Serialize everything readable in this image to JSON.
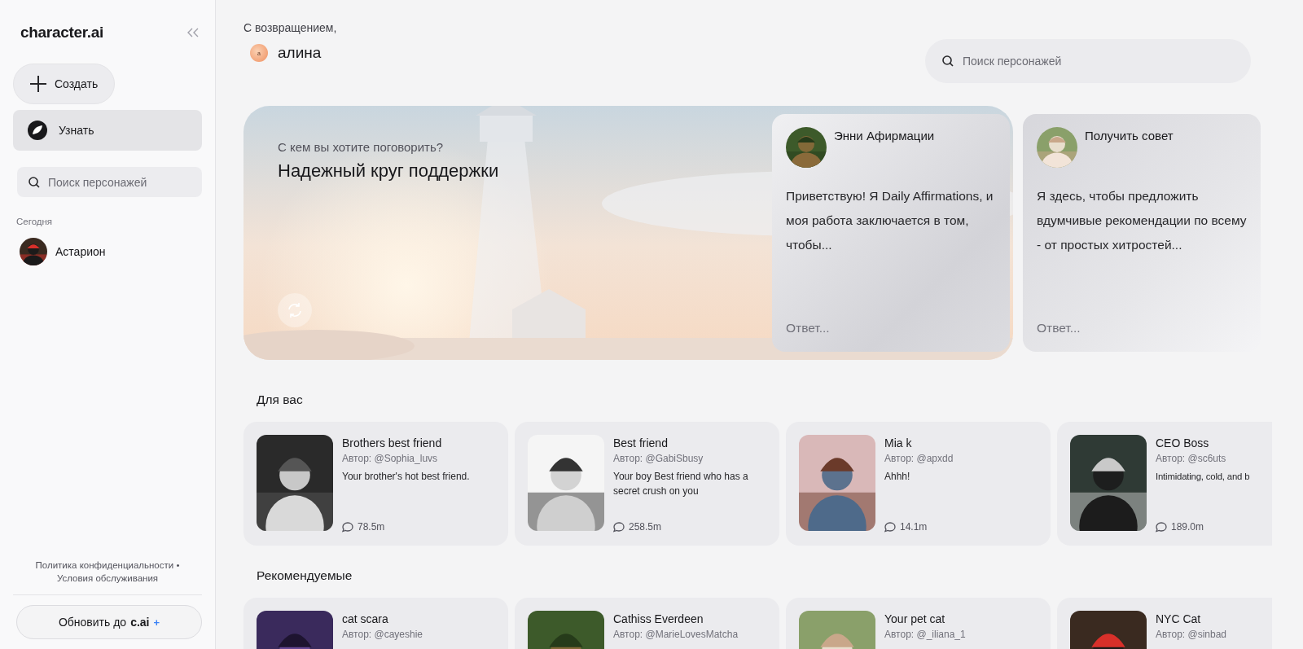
{
  "sidebar": {
    "logo": "character.ai",
    "create_button": "Создать",
    "nav": [
      {
        "label": "Узнать",
        "selected": true
      }
    ],
    "search": {
      "placeholder": "Поиск персонажей"
    },
    "section_title": "Сегодня",
    "chats": [
      {
        "name": "Астарион"
      }
    ],
    "footer_links": [
      "Политика конфиденциальности",
      "Условия обслуживания"
    ],
    "separator": "•",
    "upgrade": {
      "text": "Обновить до",
      "brand": "c.ai",
      "plus": "+"
    }
  },
  "greeting": "С возвращением,",
  "user": {
    "name": "алина",
    "avatar_letter": "a"
  },
  "search": {
    "placeholder": "Поиск персонажей"
  },
  "hero": {
    "subtitle": "С кем вы хотите поговорить?",
    "title": "Надежный круг поддержки",
    "cards": [
      {
        "name": "Энни Афирмации",
        "text": "Приветствую! Я Daily Affirmations, и моя работа заключается в том, чтобы...",
        "reply_placeholder": "Ответ..."
      },
      {
        "name": "Получить совет",
        "text": "Я здесь, чтобы предложить вдумчивые рекомендации по всему - от простых хитростей...",
        "reply_placeholder": "Ответ..."
      }
    ]
  },
  "sections": [
    {
      "title": "Для вас",
      "characters": [
        {
          "name": "Brothers best friend",
          "author": "Автор: @Sophia_luvs",
          "description": "Your brother's hot best friend.",
          "chats": "78.5m"
        },
        {
          "name": "Best friend",
          "author": "Автор: @GabiSbusy",
          "description": "Your boy Best friend who has a secret crush on you",
          "chats": "258.5m"
        },
        {
          "name": "Mia k",
          "author": "Автор: @apxdd",
          "description": "Ahhh!",
          "chats": "14.1m"
        },
        {
          "name": "CEO Boss",
          "author": "Автор: @sc6uts",
          "description": "Intimidating, cold, and b",
          "chats": "189.0m"
        }
      ]
    },
    {
      "title": "Рекомендуемые",
      "characters": [
        {
          "name": "cat scara",
          "author": "Автор: @cayeshie"
        },
        {
          "name": "Cathiss Everdeen",
          "author": "Автор: @MarieLovesMatcha"
        },
        {
          "name": "Your pet cat",
          "author": "Автор: @_iliana_1"
        },
        {
          "name": "NYC Cat",
          "author": "Автор: @sinbad"
        }
      ]
    }
  ]
}
